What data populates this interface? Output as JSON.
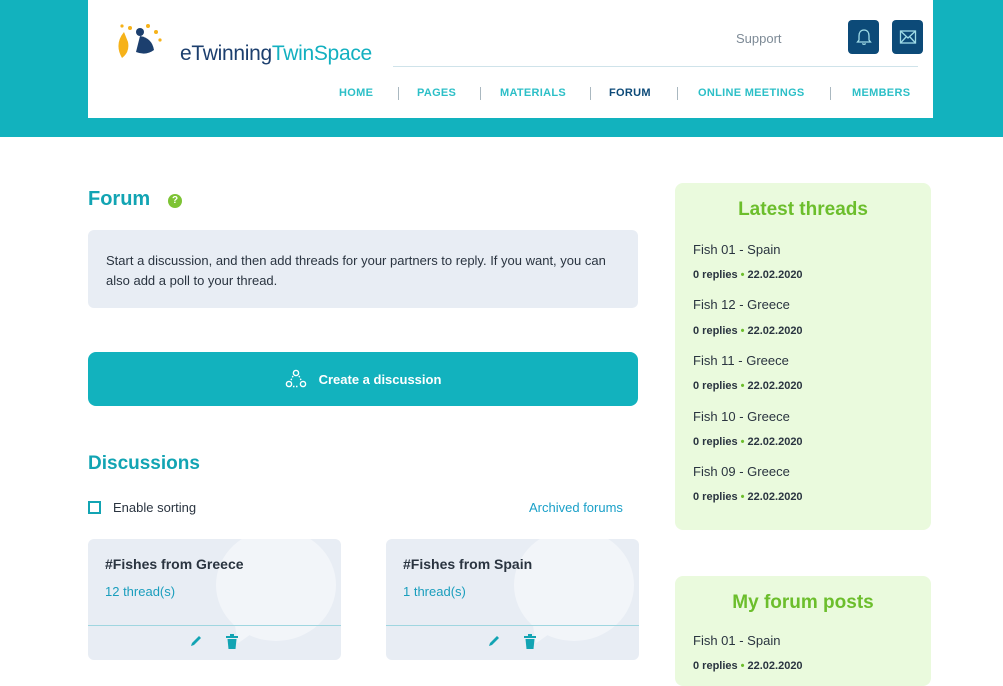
{
  "header": {
    "logo_text_1": "eTwinning",
    "logo_text_2": "TwinSpace",
    "support_label": "Support",
    "nav": [
      "HOME",
      "PAGES",
      "MATERIALS",
      "FORUM",
      "ONLINE MEETINGS",
      "MEMBERS"
    ],
    "active_nav": "FORUM",
    "icons": [
      "bell-icon",
      "envelope-icon"
    ]
  },
  "forum": {
    "title": "Forum",
    "help_glyph": "?",
    "info_text": "Start a discussion, and then add threads for your partners to reply. If you want, you can also add a poll to your thread.",
    "create_label": "Create a discussion"
  },
  "discussions": {
    "title": "Discussions",
    "sorting_label": "Enable sorting",
    "archived_label": "Archived forums",
    "cards": [
      {
        "title": "#Fishes from Greece",
        "count": "12 thread(s)"
      },
      {
        "title": "#Fishes from Spain",
        "count": "1 thread(s)"
      }
    ]
  },
  "latest_threads": {
    "title": "Latest threads",
    "items": [
      {
        "title": "Fish 01 - Spain",
        "replies": "0 replies",
        "date": "22.02.2020"
      },
      {
        "title": "Fish 12 - Greece",
        "replies": "0 replies",
        "date": "22.02.2020"
      },
      {
        "title": "Fish 11 - Greece",
        "replies": "0 replies",
        "date": "22.02.2020"
      },
      {
        "title": "Fish 10 - Greece",
        "replies": "0 replies",
        "date": "22.02.2020"
      },
      {
        "title": "Fish 09 - Greece",
        "replies": "0 replies",
        "date": "22.02.2020"
      }
    ]
  },
  "my_posts": {
    "title": "My forum posts",
    "items": [
      {
        "title": "Fish 01 - Spain",
        "replies": "0 replies",
        "date": "22.02.2020"
      }
    ]
  },
  "colors": {
    "accent": "#12b2be",
    "nav_text": "#2cbfc7",
    "dark_button": "#0c4a78",
    "panel_bg": "#eafadd",
    "panel_title": "#6cbe2c"
  }
}
